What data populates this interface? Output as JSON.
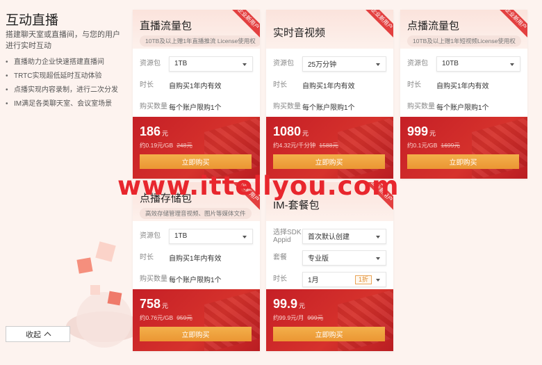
{
  "left": {
    "title": "互动直播",
    "desc": "搭建聊天室或直播间，与您的用户进行实时互动",
    "features": [
      "直播助力企业快速搭建直播间",
      "TRTC实现超低延时互动体验",
      "点播实现内容录制，进行二次分发",
      "IM满足各类聊天室、会议室场景"
    ],
    "collapse_label": "收起"
  },
  "ribbon_text": "企业新用户",
  "buy_label": "立即购买",
  "cards": {
    "c1": {
      "title": "直播流量包",
      "tag": "10TB及以上赠1年直播推流 License使用权",
      "rows": [
        {
          "label": "资源包",
          "value": "1TB"
        },
        {
          "label": "时长",
          "value": "自购买1年内有效"
        },
        {
          "label": "购买数量",
          "value": "每个账户限购1个"
        }
      ],
      "price": "186",
      "unit": "元",
      "sub": "约0.19元/GB",
      "orig": "248元"
    },
    "c2": {
      "title": "实时音视频",
      "rows": [
        {
          "label": "资源包",
          "value": "25万分钟"
        },
        {
          "label": "时长",
          "value": "自购买1年内有效"
        },
        {
          "label": "购买数量",
          "value": "每个账户限购1个"
        }
      ],
      "price": "1080",
      "unit": "元",
      "sub": "约4.32元/千分钟",
      "orig": "1588元"
    },
    "c3": {
      "title": "点播流量包",
      "tag": "10TB及以上赠1年短视频License使用权",
      "rows": [
        {
          "label": "资源包",
          "value": "10TB"
        },
        {
          "label": "时长",
          "value": "自购买1年内有效"
        },
        {
          "label": "购买数量",
          "value": "每个账户限购1个"
        }
      ],
      "price": "999",
      "unit": "元",
      "sub": "约0.1元/GB",
      "orig": "1699元"
    },
    "c4": {
      "title": "点播存储包",
      "tag": "高效存储管理音视频、图片等媒体文件",
      "rows": [
        {
          "label": "资源包",
          "value": "1TB"
        },
        {
          "label": "时长",
          "value": "自购买1年内有效"
        },
        {
          "label": "购买数量",
          "value": "每个账户限购1个"
        }
      ],
      "price": "758",
      "unit": "元",
      "sub": "约0.76元/GB",
      "orig": "959元"
    },
    "c5": {
      "title": "IM-套餐包",
      "rows": [
        {
          "label": "选择SDK Appid",
          "value": "首次默认创建"
        },
        {
          "label": "套餐",
          "value": "专业版"
        },
        {
          "label": "时长",
          "value": "1月",
          "badge": "1折"
        }
      ],
      "price": "99.9",
      "unit": "元",
      "sub": "约99.9元/月",
      "orig": "999元"
    }
  },
  "watermark": "www.ittellyou.com",
  "colors": {
    "accent_red": "#d6322c",
    "buy_orange": "#eb9633",
    "background": "#fdf3ef"
  }
}
